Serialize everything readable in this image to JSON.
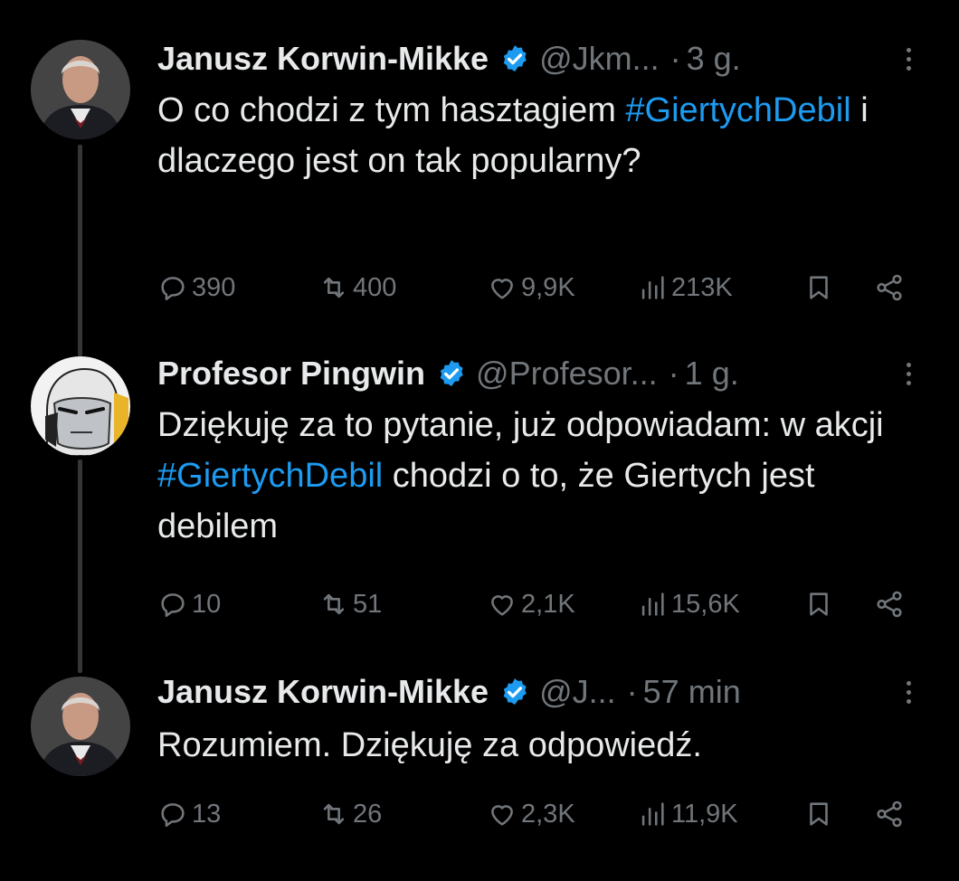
{
  "tweets": [
    {
      "author": "Janusz Korwin-Mikke",
      "handle": "@Jkm...",
      "time": "3 g.",
      "text_parts": [
        "O co chodzi z tym hasztagiem ",
        "#GiertychDebil",
        " i dlaczego jest on tak popularny?"
      ],
      "replies": "390",
      "retweets": "400",
      "likes": "9,9K",
      "views": "213K"
    },
    {
      "author": "Profesor Pingwin",
      "handle": "@Profesor...",
      "time": "1 g.",
      "text_parts": [
        "Dziękuję za to pytanie, już odpowiadam: w akcji ",
        "#GiertychDebil",
        " chodzi o to, że Giertych jest debilem"
      ],
      "replies": "10",
      "retweets": "51",
      "likes": "2,1K",
      "views": "15,6K"
    },
    {
      "author": "Janusz Korwin-Mikke",
      "handle": "@J...",
      "time": "57 min",
      "text": "Rozumiem. Dziękuję za odpowiedź.",
      "replies": "13",
      "retweets": "26",
      "likes": "2,3K",
      "views": "11,9K"
    }
  ],
  "icons": {
    "verified": "verified-badge-icon",
    "reply": "reply-icon",
    "retweet": "retweet-icon",
    "like": "heart-icon",
    "views": "views-icon",
    "bookmark": "bookmark-icon",
    "share": "share-icon",
    "more": "more-icon"
  },
  "colors": {
    "background": "#000000",
    "text": "#e7e9ea",
    "muted": "#71767b",
    "accent": "#1d9bf0"
  }
}
